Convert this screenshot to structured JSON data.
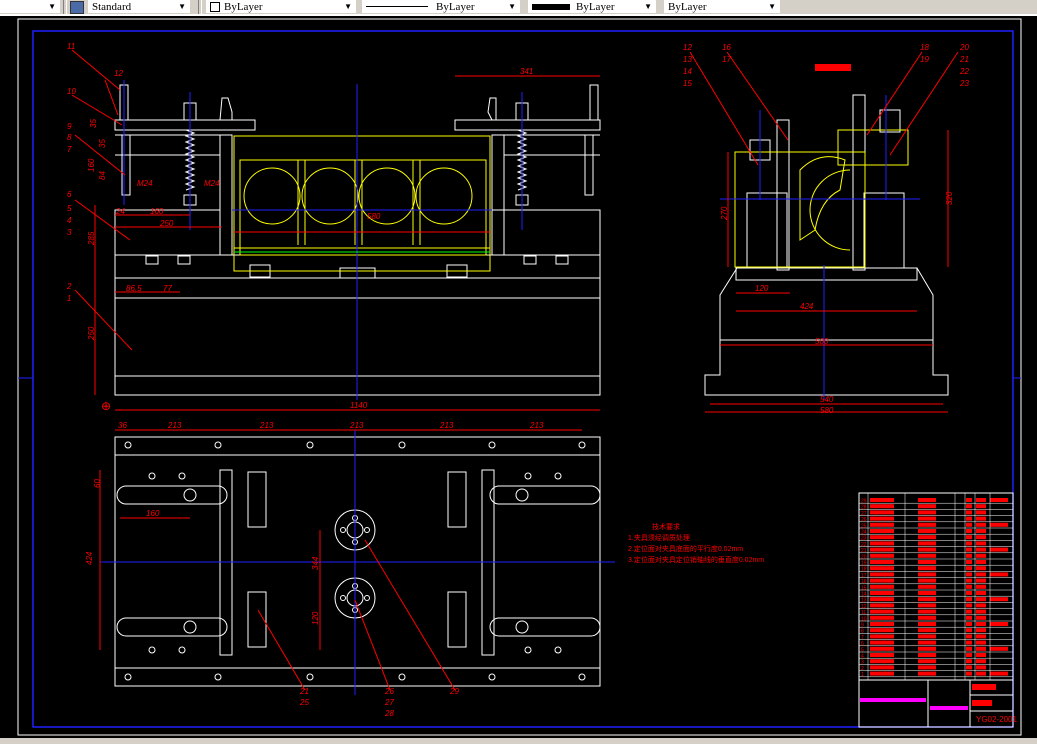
{
  "toolbar": {
    "text_style": "Standard",
    "layer_color": "ByLayer",
    "linetype": "ByLayer",
    "lineweight": "ByLayer",
    "plot_style": "ByLayer",
    "dropdown_icon": "chevron-down-icon",
    "style_icon": "text-style-icon"
  },
  "colors": {
    "outline": "#ffffff",
    "dimension": "#ff0000",
    "centerline": "#0000ff",
    "workpiece": "#ffff00",
    "green": "#00ff00",
    "frame": "#0000ff",
    "magenta": "#ff00ff"
  },
  "front_view": {
    "dims": {
      "d12": "12",
      "d341": "341",
      "d35a": "35",
      "d35b": "35",
      "d160v": "160",
      "d84": "84",
      "dM24a": "M24",
      "dM24b": "M24",
      "d24": "24",
      "d160": "160",
      "d250": "250",
      "d580": "580",
      "d285": "285",
      "d865": "86.5",
      "d77": "77",
      "d250v": "250",
      "d1140": "1140"
    },
    "balloons": [
      "11",
      "10",
      "9",
      "8",
      "7",
      "6",
      "5",
      "4",
      "3",
      "2",
      "1"
    ]
  },
  "side_view": {
    "dims": {
      "d270": "270",
      "d320": "320",
      "d120": "120",
      "d424": "424",
      "d500": "500",
      "d540": "540",
      "d580": "580"
    },
    "balloons_left": [
      "12",
      "13",
      "14",
      "15"
    ],
    "balloons_mid": [
      "16",
      "17"
    ],
    "balloons_r1": [
      "18",
      "19"
    ],
    "balloons_r2": [
      "20",
      "21",
      "22",
      "23"
    ]
  },
  "plan_view": {
    "dims": {
      "t36": "36",
      "t213a": "213",
      "t213b": "213",
      "t213c": "213",
      "t213d": "213",
      "t213e": "213",
      "d60": "60",
      "d160": "160",
      "d424": "424",
      "d344": "344",
      "d120": "120"
    },
    "balloons": [
      "21",
      "25",
      "26",
      "27",
      "28",
      "29"
    ]
  },
  "notes": {
    "title": "技术要求",
    "lines": [
      "1.夹具须经调质处理",
      "2.定位面对夹具底面的平行度0.02mm",
      "3.定位面对夹具定位销轴线的垂直度0.02mm"
    ]
  },
  "title_block": {
    "row_numbers": [
      "29",
      "28",
      "27",
      "26",
      "25",
      "24",
      "23",
      "22",
      "21",
      "20",
      "19",
      "18",
      "17",
      "16",
      "15",
      "14",
      "13",
      "12",
      "11",
      "10",
      "9",
      "8",
      "7",
      "6",
      "5",
      "4",
      "3",
      "2",
      "1"
    ],
    "drawing_number": "YG02-2001"
  }
}
